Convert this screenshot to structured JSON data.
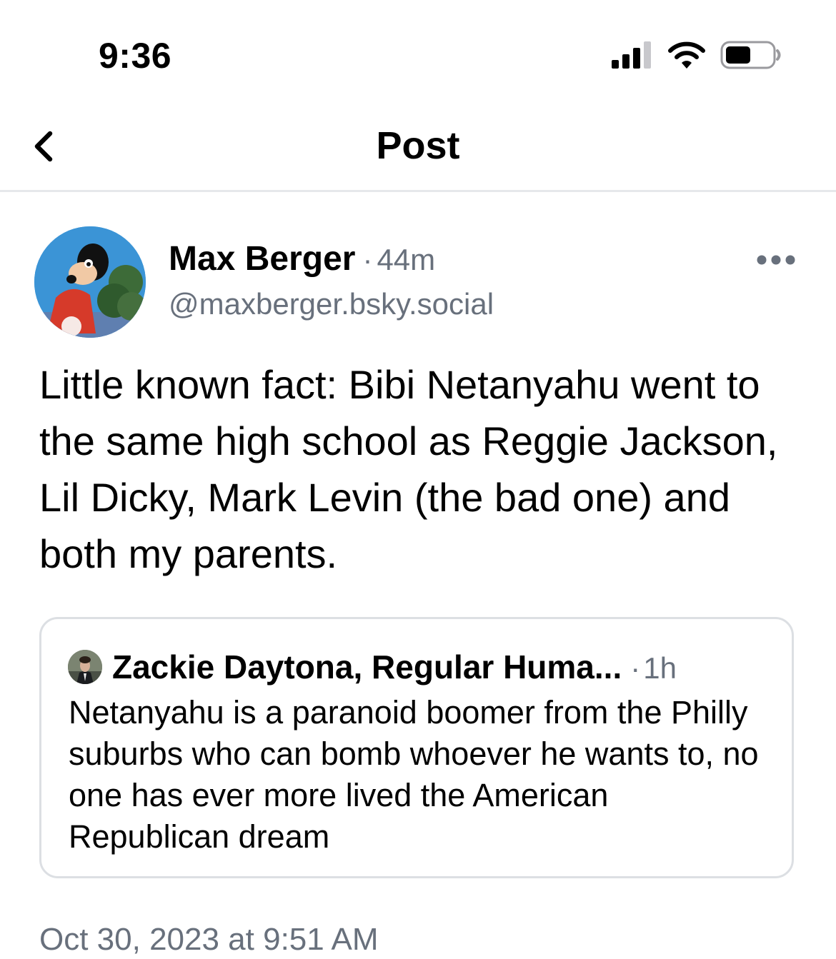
{
  "status_bar": {
    "time": "9:36",
    "icons": [
      "cellular-signal-icon",
      "wifi-icon",
      "battery-icon"
    ]
  },
  "header": {
    "back_icon": "chevron-left-icon",
    "title": "Post"
  },
  "post": {
    "author_name": "Max Berger",
    "separator": "·",
    "age": "44m",
    "handle": "@maxberger.bsky.social",
    "more_icon": "ellipsis-icon",
    "text": "Little known fact: Bibi Netanyahu went to the same high school as Reggie Jackson, Lil Dicky, Mark Levin (the bad one) and both my parents.",
    "timestamp": "Oct 30, 2023 at 9:51 AM"
  },
  "quote": {
    "author_name": "Zackie Daytona, Regular Huma...",
    "separator": "·",
    "age": "1h",
    "text": "Netanyahu is a paranoid boomer from the Philly suburbs who can bomb whoever he wants to, no one has ever more lived the American Republican dream"
  },
  "colors": {
    "text": "#000000",
    "muted": "#68707c",
    "divider": "#e6e8eb",
    "card_border": "#dcdfe3",
    "background": "#ffffff"
  }
}
